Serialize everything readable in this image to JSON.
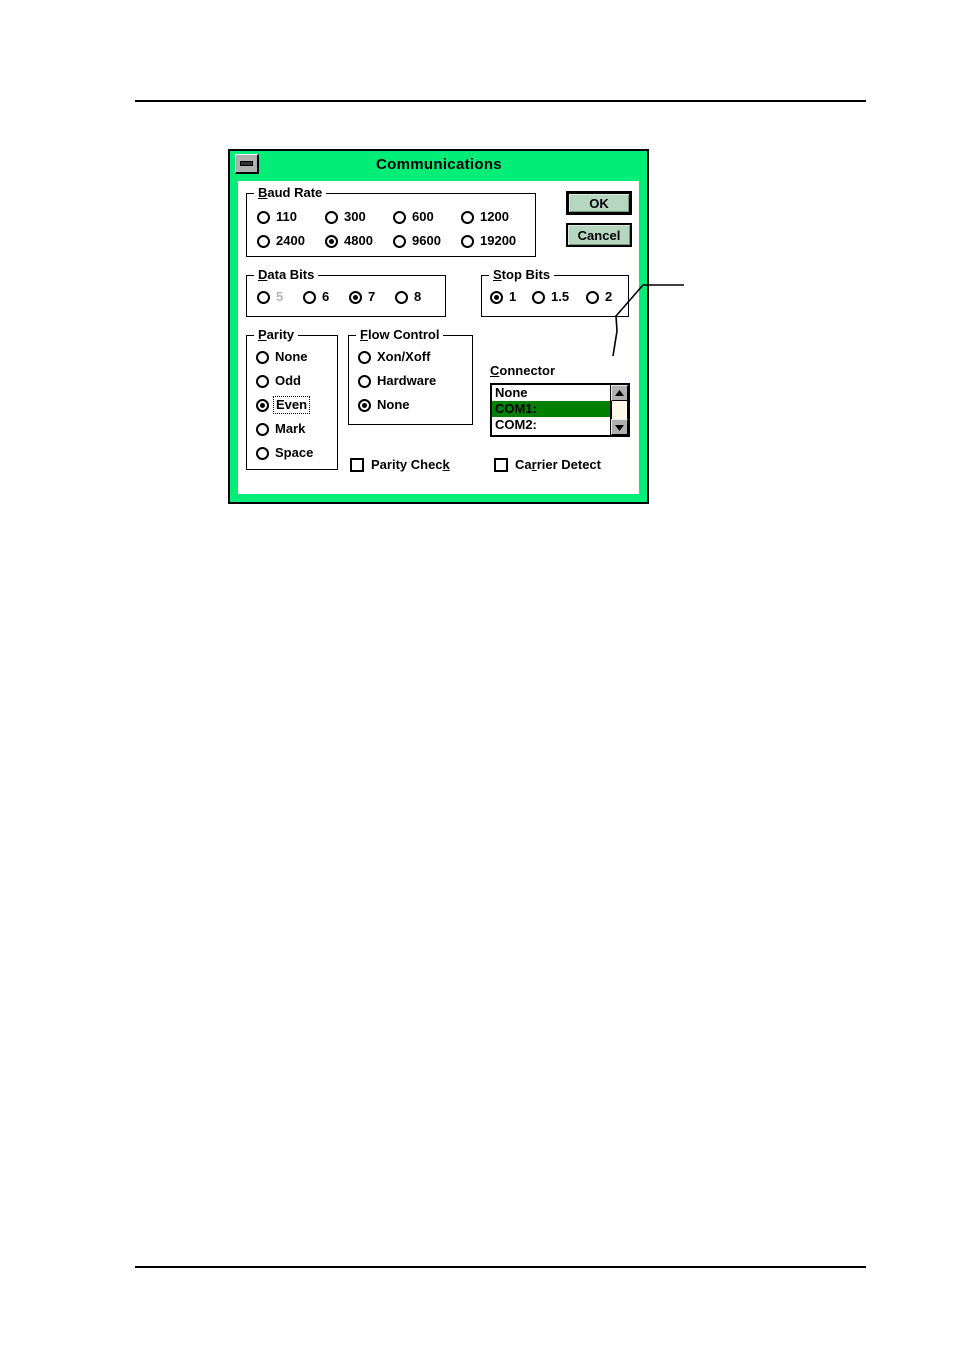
{
  "page": {
    "header_rule": true,
    "footer_rule": true
  },
  "dialog": {
    "title": "Communications",
    "minimize_icon": "minimize-icon",
    "frame_color": "#00ee77",
    "client_color": "#ffffff",
    "buttons": [
      {
        "label": "OK",
        "default": true
      },
      {
        "label": "Cancel",
        "default": false
      }
    ],
    "groups": {
      "baud_rate": {
        "legend_pre": "B",
        "legend_post": "aud Rate",
        "accelerator": "B",
        "options": [
          {
            "label": "110",
            "selected": false,
            "disabled": false
          },
          {
            "label": "300",
            "selected": false,
            "disabled": false
          },
          {
            "label": "600",
            "selected": false,
            "disabled": false
          },
          {
            "label": "1200",
            "selected": false,
            "disabled": false
          },
          {
            "label": "2400",
            "selected": false,
            "disabled": false
          },
          {
            "label": "4800",
            "selected": true,
            "disabled": false
          },
          {
            "label": "9600",
            "selected": false,
            "disabled": false
          },
          {
            "label": "19200",
            "selected": false,
            "disabled": false
          }
        ],
        "selected_value": "4800"
      },
      "data_bits": {
        "legend_pre": "D",
        "legend_post": "ata Bits",
        "accelerator": "D",
        "options": [
          {
            "label": "5",
            "selected": false,
            "disabled": true
          },
          {
            "label": "6",
            "selected": false,
            "disabled": false
          },
          {
            "label": "7",
            "selected": true,
            "disabled": false
          },
          {
            "label": "8",
            "selected": false,
            "disabled": false
          }
        ],
        "selected_value": "7"
      },
      "stop_bits": {
        "legend_pre": "S",
        "legend_post": "top Bits",
        "accelerator": "S",
        "options": [
          {
            "label": "1",
            "selected": true,
            "disabled": false
          },
          {
            "label": "1.5",
            "selected": false,
            "disabled": false
          },
          {
            "label": "2",
            "selected": false,
            "disabled": false
          }
        ],
        "selected_value": "1"
      },
      "parity": {
        "legend_pre": "P",
        "legend_post": "arity",
        "accelerator": "P",
        "options": [
          {
            "label": "None",
            "selected": false,
            "disabled": false,
            "focused": false
          },
          {
            "label": "Odd",
            "selected": false,
            "disabled": false,
            "focused": false
          },
          {
            "label": "Even",
            "selected": true,
            "disabled": false,
            "focused": true
          },
          {
            "label": "Mark",
            "selected": false,
            "disabled": false,
            "focused": false
          },
          {
            "label": "Space",
            "selected": false,
            "disabled": false,
            "focused": false
          }
        ],
        "selected_value": "Even"
      },
      "flow_control": {
        "legend_pre": "F",
        "legend_post": "low Control",
        "accelerator": "F",
        "options": [
          {
            "label": "Xon/Xoff",
            "selected": false,
            "disabled": false
          },
          {
            "label": "Hardware",
            "selected": false,
            "disabled": false
          },
          {
            "label": "None",
            "selected": true,
            "disabled": false
          }
        ],
        "selected_value": "None"
      }
    },
    "connector": {
      "caption_pre": "C",
      "caption_post": "onnector",
      "accelerator": "C",
      "items": [
        {
          "label": "None",
          "selected": false
        },
        {
          "label": "COM1:",
          "selected": true
        },
        {
          "label": "COM2:",
          "selected": false
        }
      ],
      "selected_value": "COM1:",
      "highlight_color": "#008000",
      "scrollbar": {
        "up_icon": "scroll-up-arrow-icon",
        "down_icon": "scroll-down-arrow-icon",
        "thumb_color": "#fdf9e8"
      }
    },
    "checkboxes": [
      {
        "label_pre": "Parity Chec",
        "label_acc": "k",
        "label_post": "",
        "checked": false,
        "name": "parity-check"
      },
      {
        "label_pre": "Ca",
        "label_acc": "r",
        "label_post": "rier Detect",
        "checked": false,
        "name": "carrier-detect"
      }
    ]
  }
}
